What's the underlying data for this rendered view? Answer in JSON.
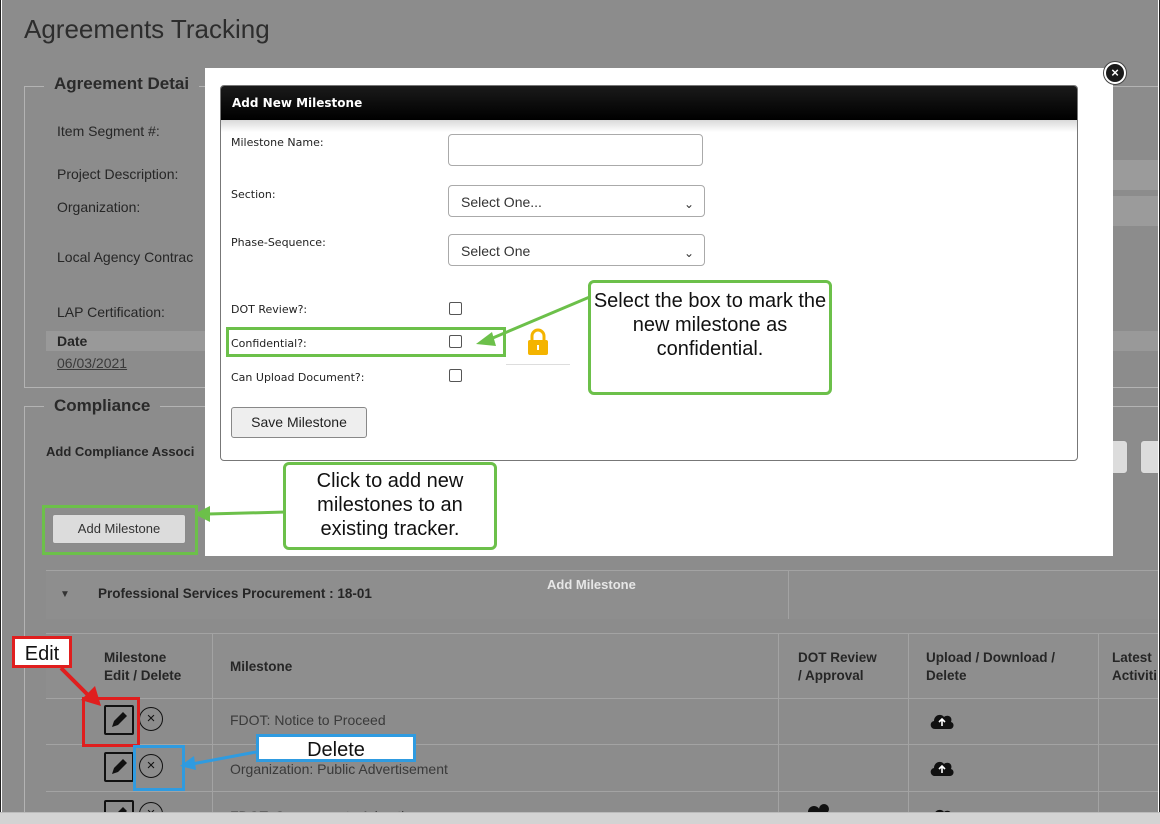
{
  "page": {
    "title": "Agreements Tracking"
  },
  "agreement_details": {
    "legend": "Agreement Detai",
    "item_segment_label": "Item Segment #:",
    "project_description_label": "Project Description:",
    "organization_label": "Organization:",
    "local_agency_contract_label": "Local Agency Contrac",
    "lap_certification_label": "LAP Certification:",
    "date_header": "Date",
    "date_value": "06/03/2021"
  },
  "compliance": {
    "legend": "Compliance",
    "add_compliance_label": "Add Compliance Associ",
    "add_milestone_button": "Add Milestone"
  },
  "grid": {
    "group_title": "Professional Services Procurement : 18-01",
    "add_milestone_overlay": "Add Milestone",
    "columns": [
      "Milestone\nEdit / Delete",
      "Milestone",
      "DOT Review\n/ Approval",
      "Upload / Download /\nDelete",
      "Latest\nActiviti"
    ],
    "rows": [
      {
        "milestone": "FDOT: Notice to Proceed"
      },
      {
        "milestone": "Organization: Public Advertisement"
      },
      {
        "milestone": "FDOT: Consummate Advertise..."
      }
    ]
  },
  "modal": {
    "title": "Add New Milestone",
    "milestone_name_label": "Milestone Name:",
    "milestone_name_value": "",
    "section_label": "Section:",
    "section_value": "Select One...",
    "phase_label": "Phase-Sequence:",
    "phase_value": "Select One",
    "dot_review_label": "DOT Review?:",
    "confidential_label": "Confidential?:",
    "can_upload_label": "Can Upload Document?:",
    "save_button": "Save Milestone"
  },
  "annotations": {
    "confidential_callout": "Select the box to mark the new milestone as confidential.",
    "add_milestone_callout": "Click to add new milestones to an existing tracker.",
    "edit_tag": "Edit",
    "delete_tag": "Delete"
  },
  "colors": {
    "callout_green": "#6cc04a",
    "edit_red": "#e01e1e",
    "delete_blue": "#2f9be0",
    "modal_header": "#000000",
    "overlay_gray": "#8c8c8c"
  }
}
